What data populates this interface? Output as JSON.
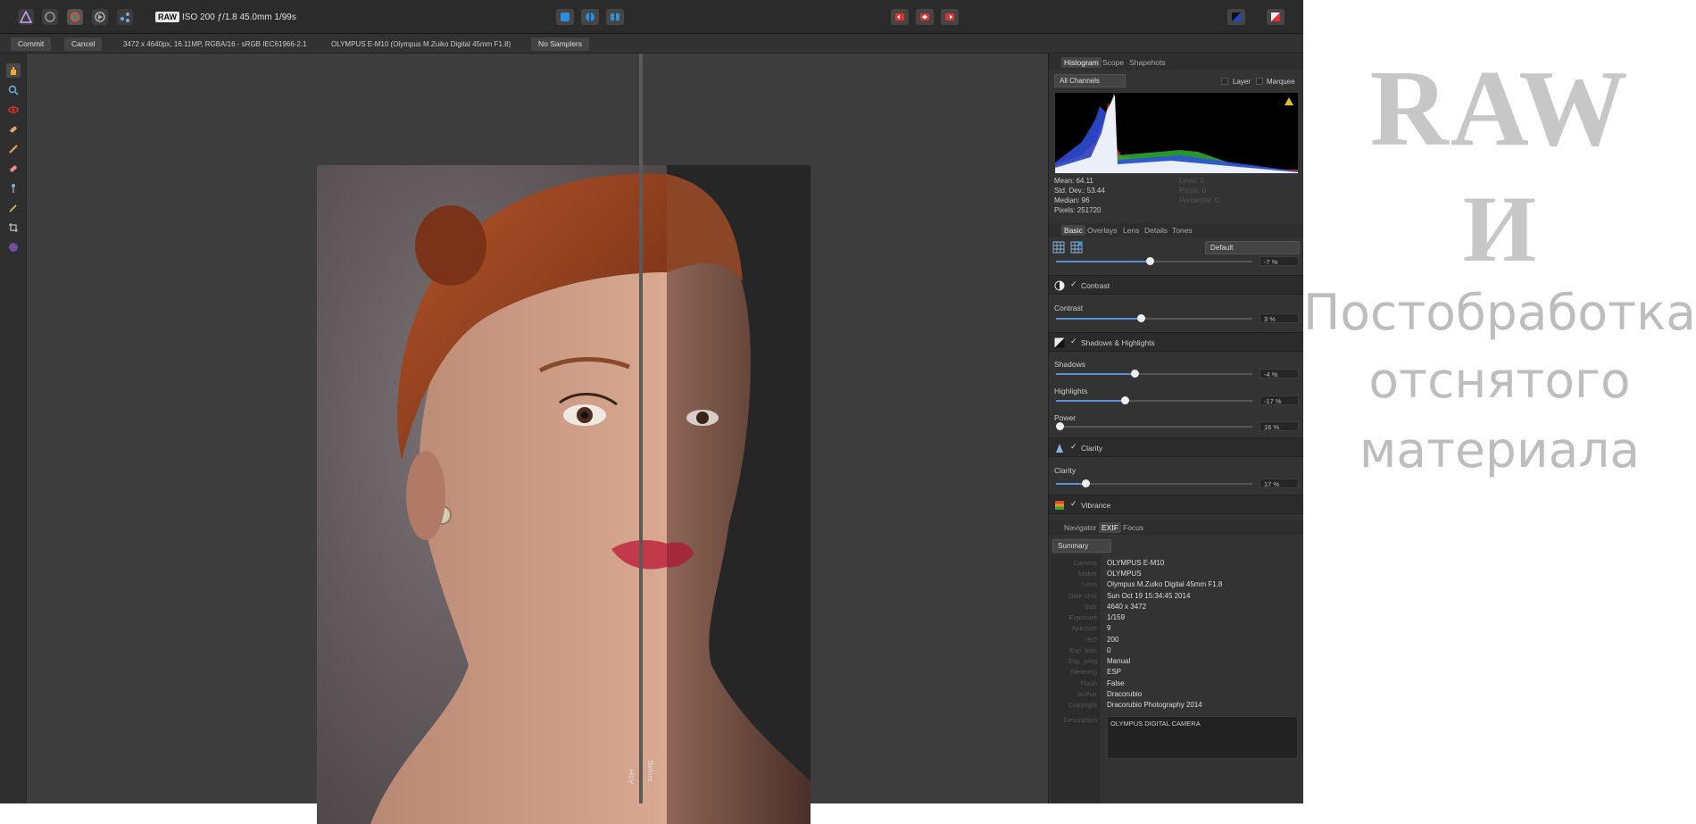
{
  "topbar": {
    "raw_badge": "RAW",
    "exif_summary": "ISO 200 ƒ/1.8 45.0mm 1/99s"
  },
  "context_bar": {
    "commit_label": "Commit",
    "cancel_label": "Cancel",
    "image_info": "3472 x 4640px, 16.11MP, RGBA/16 - sRGB IEC61966-2.1",
    "camera_info": "OLYMPUS E-M10 (Olympus M.Zuiko Digital 45mm F1.8)",
    "samplers_label": "No Samplers"
  },
  "split_view": {
    "after_label": "After",
    "before_label": "Before"
  },
  "histogram_panel": {
    "tabs": [
      "Histogram",
      "Scope",
      "Shapehots"
    ],
    "channel_select": "All Channels",
    "layer_label": "Layer",
    "marquee_label": "Marquee",
    "stats": {
      "mean": "Mean: 64.11",
      "std_dev": "Std. Dev.: 53.44",
      "median": "Median: 96",
      "pixels": "Pixels: 251720",
      "level": "Level: 0",
      "pixels_r": "Pixels: 0",
      "percentile": "Percentile: 0"
    }
  },
  "develop_panel": {
    "tabs": [
      "Basic",
      "Overlays",
      "Lens",
      "Details",
      "Tones"
    ],
    "preset_select": "Default",
    "top_value": "-7 %",
    "sections": {
      "contrast": {
        "title": "Contrast",
        "slider_label": "Contrast",
        "value": "3 %",
        "level": 0.43
      },
      "shadows_highlights": {
        "title": "Shadows & Highlights",
        "shadows_label": "Shadows",
        "shadows_value": "-4 %",
        "shadows_level": 0.4,
        "highlights_label": "Highlights",
        "highlights_value": "-17 %",
        "highlights_level": 0.35,
        "power_label": "Power",
        "power_value": "16 %",
        "power_level": 0.02
      },
      "clarity": {
        "title": "Clarity",
        "slider_label": "Clarity",
        "value": "17 %",
        "level": 0.15
      },
      "vibrance": {
        "title": "Vibrance"
      }
    }
  },
  "info_panel": {
    "tabs": [
      "Navigator",
      "EXIF",
      "Focus"
    ],
    "view_select": "Summary",
    "exif_rows": [
      {
        "key": "Camera",
        "value": "OLYMPUS E-M10"
      },
      {
        "key": "Maker",
        "value": "OLYMPUS"
      },
      {
        "key": "Lens",
        "value": "Olympus M.Zuiko Digital 45mm F1.8"
      },
      {
        "key": "Date shot",
        "value": "Sun Oct 19 15:34:45 2014"
      },
      {
        "key": "Size",
        "value": "4640 x 3472"
      },
      {
        "key": "Exposure",
        "value": "1/159"
      },
      {
        "key": "Aperture",
        "value": "9"
      },
      {
        "key": "ISO",
        "value": "200"
      },
      {
        "key": "Exp. bias",
        "value": "0"
      },
      {
        "key": "Exp. prog",
        "value": "Manual"
      },
      {
        "key": "Metering",
        "value": "ESP"
      },
      {
        "key": "Flash",
        "value": "False"
      },
      {
        "key": "Author",
        "value": "Dracorubio"
      },
      {
        "key": "Copyright",
        "value": "Dracorubio Photography 2014"
      }
    ],
    "description_label": "Description",
    "description_value": "OLYMPUS DIGITAL CAMERA"
  },
  "title_overlay": {
    "line1": "RAW",
    "line2": "И",
    "line3": "Постобработка",
    "line4": "отснятого",
    "line5": "материала"
  }
}
